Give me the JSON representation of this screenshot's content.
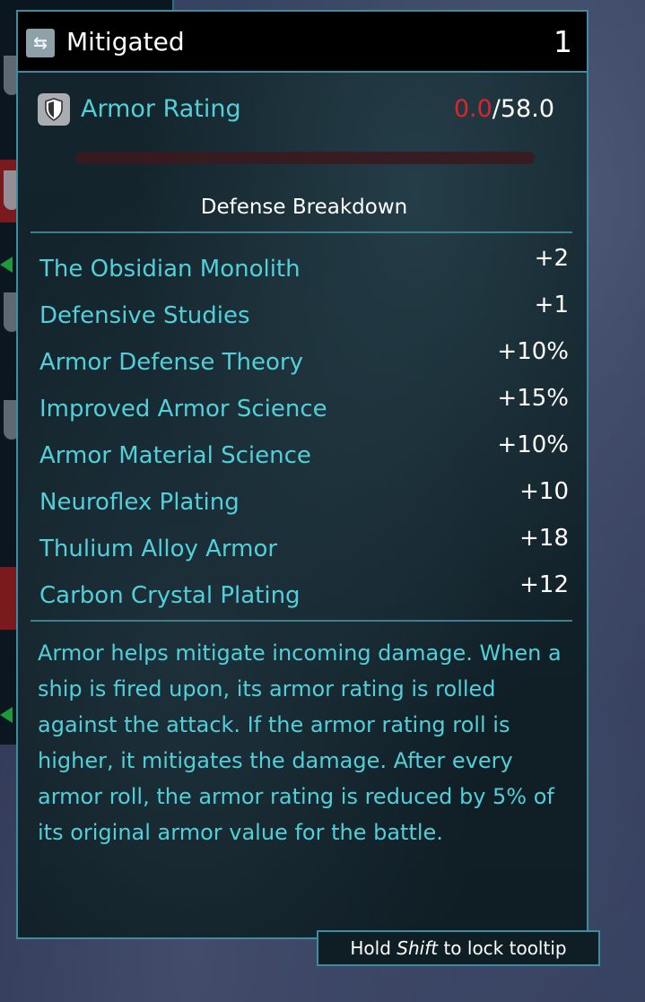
{
  "tooltip": {
    "title": "Mitigated",
    "title_icon": "swap-arrows-icon",
    "count": "1",
    "armor": {
      "icon": "shield-icon",
      "label": "Armor Rating",
      "current": "0.0",
      "separator": "/",
      "max": "58.0",
      "current_color": "#e0242c",
      "fill_fraction": 0.0
    },
    "breakdown_title": "Defense Breakdown",
    "breakdown": [
      {
        "name": "The Obsidian Monolith",
        "value": "+2"
      },
      {
        "name": "Defensive Studies",
        "value": "+1"
      },
      {
        "name": "Armor Defense Theory",
        "value": "+10%"
      },
      {
        "name": "Improved Armor Science",
        "value": "+15%"
      },
      {
        "name": "Armor Material Science",
        "value": "+10%"
      },
      {
        "name": "Neuroflex Plating",
        "value": "+10"
      },
      {
        "name": "Thulium Alloy Armor",
        "value": "+18"
      },
      {
        "name": "Carbon Crystal Plating",
        "value": "+12"
      }
    ],
    "description": "Armor helps mitigate incoming damage. When a ship is fired upon, its armor rating is rolled against the attack. If the armor rating roll is higher, it mitigates the damage. After every armor roll, the armor rating is reduced by 5% of its original armor value for the battle.",
    "accent_color": "#52cfd8"
  },
  "hint": {
    "before": "Hold ",
    "key": "Shift",
    "after": " to lock tooltip"
  }
}
